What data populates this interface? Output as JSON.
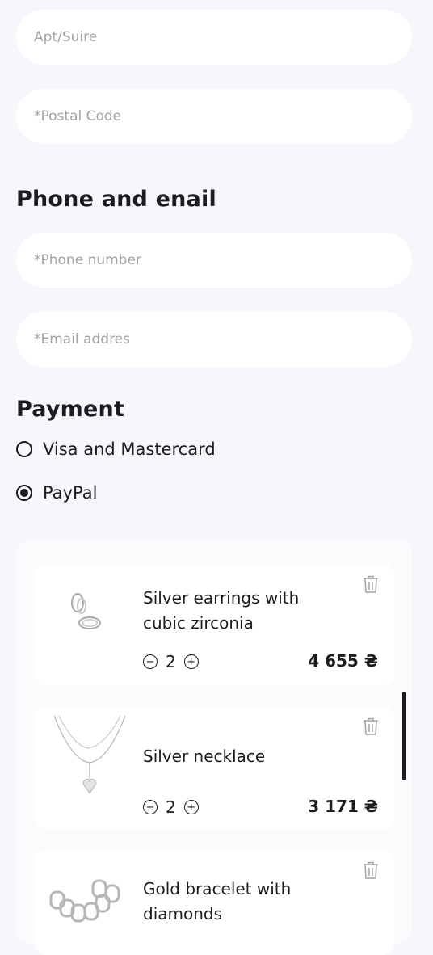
{
  "address": {
    "apt_placeholder": "Apt/Suire",
    "postal_placeholder": "*Postal Code"
  },
  "contact": {
    "heading": "Phone and enail",
    "phone_placeholder": "*Phone number",
    "email_placeholder": "*Email addres"
  },
  "payment": {
    "heading": "Payment",
    "options": [
      {
        "label": "Visa and Mastercard",
        "selected": false
      },
      {
        "label": "PayPal",
        "selected": true
      }
    ]
  },
  "cart": {
    "items": [
      {
        "name_line1": "Silver earrings with",
        "name_line2": "cubic zirconia",
        "qty": "2",
        "price": "4 655 ₴",
        "icon": "earrings-image"
      },
      {
        "name_line1": "Silver necklace",
        "name_line2": "",
        "qty": "2",
        "price": "3 171 ₴",
        "icon": "necklace-image"
      },
      {
        "name_line1": "Gold bracelet with",
        "name_line2": "diamonds",
        "qty": "",
        "price": "",
        "icon": "bracelet-image"
      }
    ],
    "qty_minus": "−",
    "qty_plus": "+"
  }
}
